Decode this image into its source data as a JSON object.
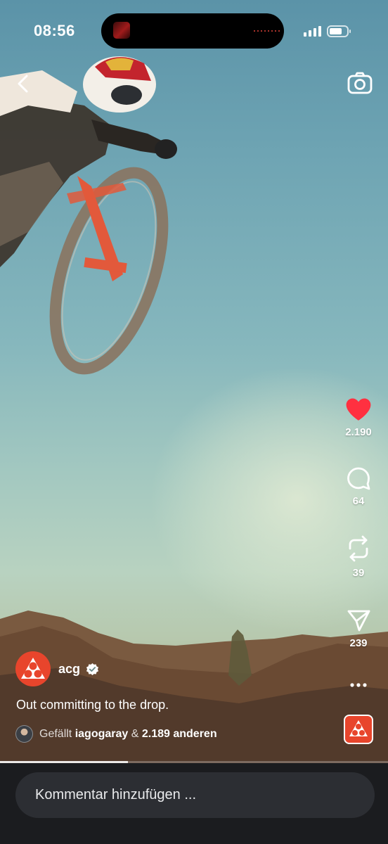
{
  "status_bar": {
    "time": "08:56"
  },
  "top_bar": {
    "back_icon": "chevron-left-icon",
    "camera_icon": "camera-icon"
  },
  "actions": {
    "like": {
      "icon": "heart-filled-icon",
      "count": "2.190",
      "color": "#ff3040"
    },
    "comment": {
      "icon": "speech-bubble-icon",
      "count": "64"
    },
    "repost": {
      "icon": "repost-icon",
      "count": "39"
    },
    "share": {
      "icon": "paper-plane-icon",
      "count": "239"
    },
    "more": {
      "icon": "more-dots-icon"
    }
  },
  "post": {
    "username": "acg",
    "verified": true,
    "caption": "Out committing to the drop.",
    "likes": {
      "prefix": "Gefällt",
      "user": "iagogaray",
      "connector": "&",
      "others": "2.189 anderen"
    },
    "brand_color": "#e8452c"
  },
  "playback": {
    "progress": 0.33
  },
  "comment_box": {
    "placeholder": "Kommentar hinzufügen ..."
  }
}
